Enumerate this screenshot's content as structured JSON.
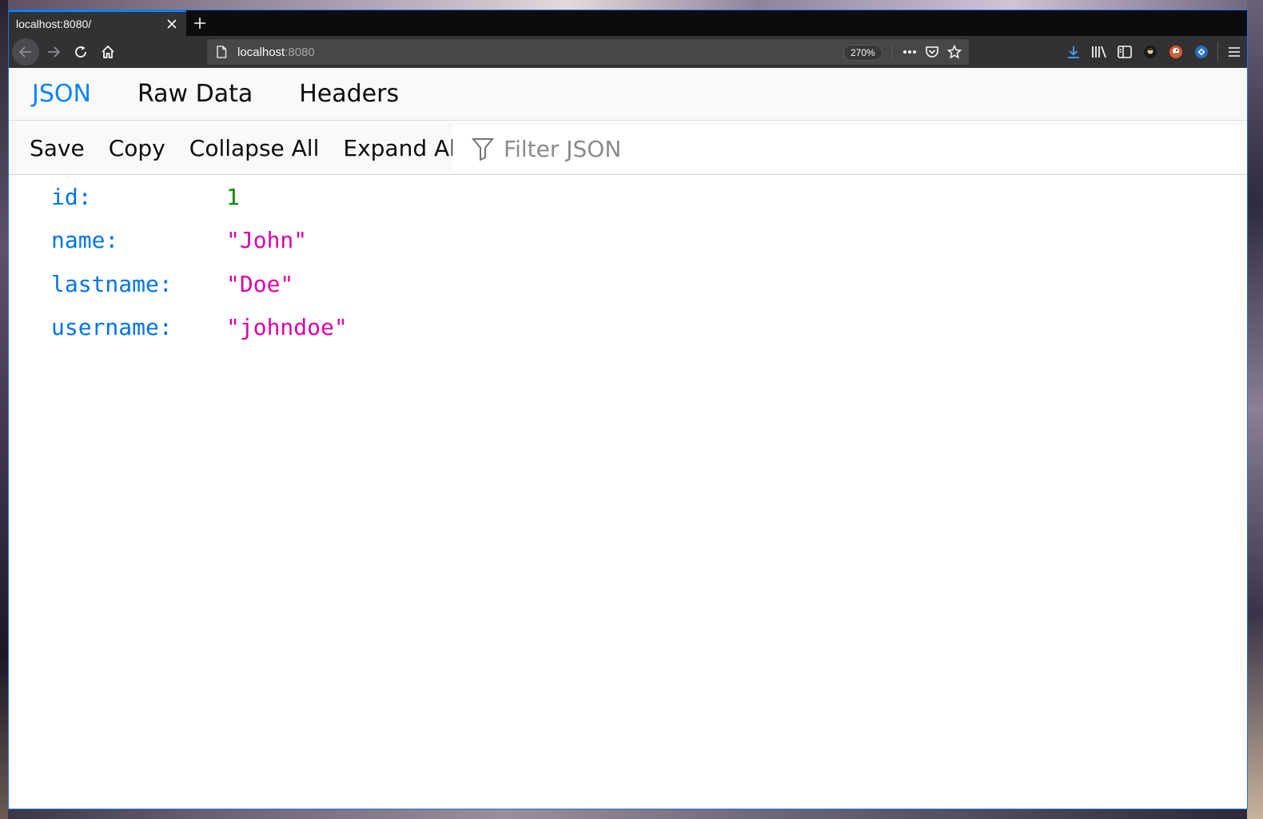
{
  "browser": {
    "tab": {
      "title": "localhost:8080/"
    },
    "url": {
      "host": "localhost",
      "port": ":8080"
    },
    "zoom": "270%"
  },
  "viewer": {
    "tabs": [
      {
        "label": "JSON",
        "active": true
      },
      {
        "label": "Raw Data",
        "active": false
      },
      {
        "label": "Headers",
        "active": false
      }
    ],
    "toolbar": {
      "save": "Save",
      "copy": "Copy",
      "collapse_all": "Collapse All",
      "expand_all": "Expand All",
      "filter_placeholder": "Filter JSON"
    },
    "rows": [
      {
        "key": "id:",
        "value": "1",
        "type": "number"
      },
      {
        "key": "name:",
        "value": "\"John\"",
        "type": "string"
      },
      {
        "key": "lastname:",
        "value": "\"Doe\"",
        "type": "string"
      },
      {
        "key": "username:",
        "value": "\"johndoe\"",
        "type": "string"
      }
    ]
  },
  "colors": {
    "accent": "#0a84ff",
    "json_key": "#0074e8",
    "json_number": "#058b00",
    "json_string": "#dd00a9"
  },
  "icons": [
    "page-icon",
    "back-arrow-icon",
    "forward-arrow-icon",
    "reload-icon",
    "home-icon",
    "more-dots-icon",
    "pocket-icon",
    "star-icon",
    "download-icon",
    "library-icon",
    "sidebar-icon",
    "extension-icon",
    "duckduckgo-icon",
    "puzzle-icon",
    "hamburger-menu-icon",
    "filter-funnel-icon",
    "close-icon",
    "plus-icon"
  ]
}
